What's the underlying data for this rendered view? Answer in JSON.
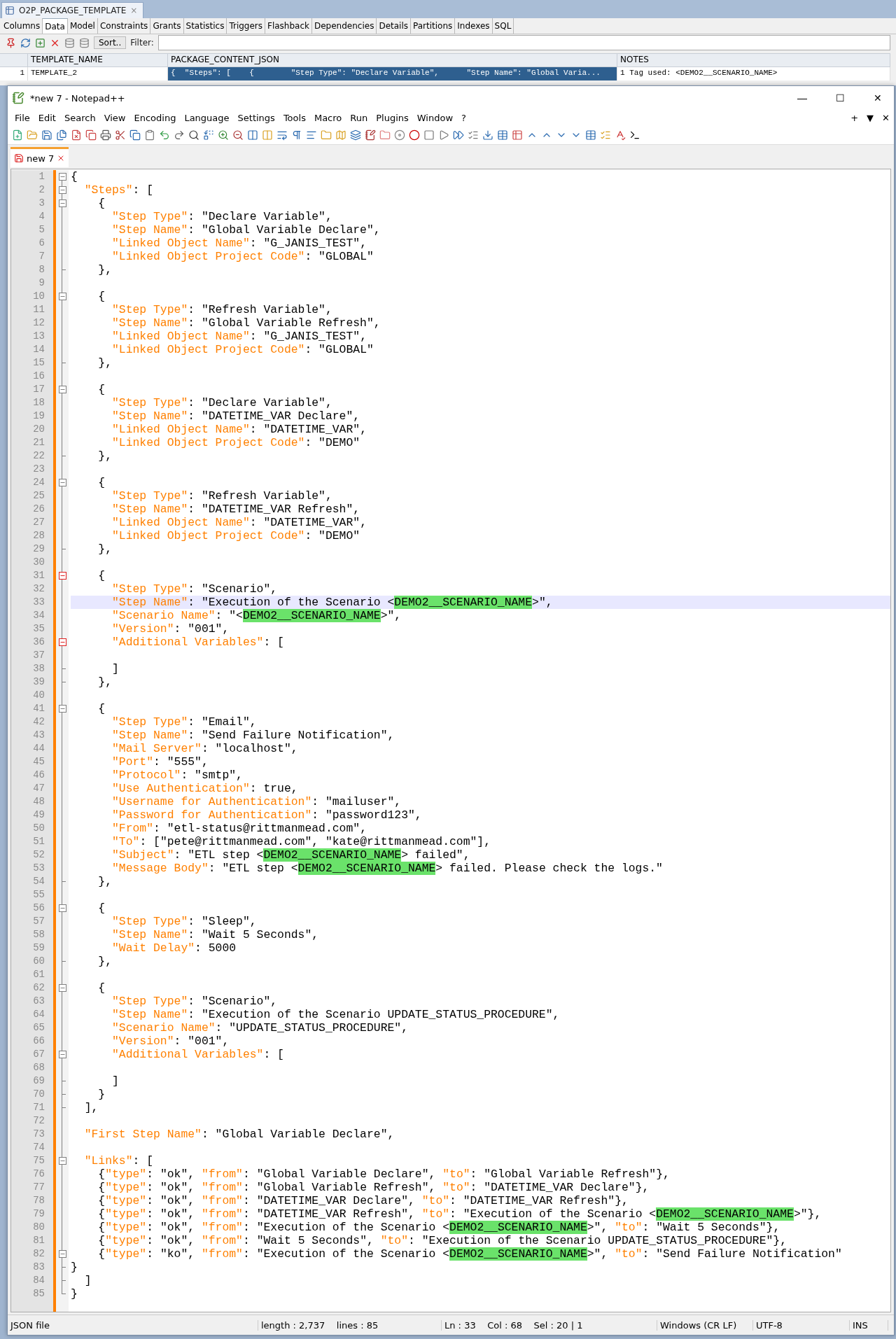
{
  "sql_developer": {
    "object_tab": {
      "title": "O2P_PACKAGE_TEMPLATE",
      "close": "×"
    },
    "tabs": [
      {
        "label": "Columns",
        "selected": false
      },
      {
        "label": "Data",
        "selected": true
      },
      {
        "label": "Model",
        "selected": false
      },
      {
        "label": "Constraints",
        "selected": false
      },
      {
        "label": "Grants",
        "selected": false
      },
      {
        "label": "Statistics",
        "selected": false
      },
      {
        "label": "Triggers",
        "selected": false
      },
      {
        "label": "Flashback",
        "selected": false
      },
      {
        "label": "Dependencies",
        "selected": false
      },
      {
        "label": "Details",
        "selected": false
      },
      {
        "label": "Partitions",
        "selected": false
      },
      {
        "label": "Indexes",
        "selected": false
      },
      {
        "label": "SQL",
        "selected": false
      }
    ],
    "sort_button": "Sort..",
    "filter_label": "Filter:",
    "grid": {
      "columns": [
        "TEMPLATE_NAME",
        "PACKAGE_CONTENT_JSON",
        "NOTES"
      ],
      "rows": [
        {
          "number": "1",
          "cells": [
            {
              "text": "TEMPLATE_2",
              "selected": false
            },
            {
              "text": "{  \"Steps\": [    {        \"Step Type\": \"Declare Variable\",      \"Step Name\": \"Global Varia...",
              "selected": true
            },
            {
              "text": "1 Tag used: <DEMO2__SCENARIO_NAME>",
              "selected": false
            }
          ]
        }
      ]
    }
  },
  "notepad": {
    "title": "*new 7 - Notepad++",
    "window_buttons": [
      "—",
      "☐",
      "✕"
    ],
    "menu": [
      "File",
      "Edit",
      "Search",
      "View",
      "Encoding",
      "Language",
      "Settings",
      "Tools",
      "Macro",
      "Run",
      "Plugins",
      "Window",
      "?"
    ],
    "menu_right": [
      "+",
      "▼",
      "✕"
    ],
    "tab": {
      "label": "new 7",
      "selected": true
    },
    "lines": [
      {
        "n": "1",
        "kind": "opener",
        "current": false,
        "segs": [
          {
            "kind": "text",
            "text": "{"
          }
        ]
      },
      {
        "n": "2",
        "kind": "opener",
        "current": false,
        "segs": [
          {
            "kind": "key",
            "text": "  \"Steps\""
          },
          {
            "kind": "text",
            "text": ": ["
          }
        ]
      },
      {
        "n": "3",
        "kind": "opener",
        "current": false,
        "segs": [
          {
            "kind": "text",
            "text": "    {"
          }
        ]
      },
      {
        "n": "4",
        "kind": "plain",
        "current": false,
        "segs": [
          {
            "kind": "key",
            "text": "      \"Step Type\""
          },
          {
            "kind": "text",
            "text": ": \"Declare Variable\","
          }
        ]
      },
      {
        "n": "5",
        "kind": "plain",
        "current": false,
        "segs": [
          {
            "kind": "key",
            "text": "      \"Step Name\""
          },
          {
            "kind": "text",
            "text": ": \"Global Variable Declare\","
          }
        ]
      },
      {
        "n": "6",
        "kind": "plain",
        "current": false,
        "segs": [
          {
            "kind": "key",
            "text": "      \"Linked Object Name\""
          },
          {
            "kind": "text",
            "text": ": \"G_JANIS_TEST\","
          }
        ]
      },
      {
        "n": "7",
        "kind": "plain",
        "current": false,
        "segs": [
          {
            "kind": "key",
            "text": "      \"Linked Object Project Code\""
          },
          {
            "kind": "text",
            "text": ": \"GLOBAL\""
          }
        ]
      },
      {
        "n": "8",
        "kind": "closer",
        "current": false,
        "segs": [
          {
            "kind": "text",
            "text": "    },"
          }
        ]
      },
      {
        "n": "9",
        "kind": "plain",
        "current": false
      },
      {
        "n": "10",
        "kind": "opener",
        "current": false,
        "segs": [
          {
            "kind": "text",
            "text": "    {"
          }
        ]
      },
      {
        "n": "11",
        "kind": "plain",
        "current": false,
        "segs": [
          {
            "kind": "key",
            "text": "      \"Step Type\""
          },
          {
            "kind": "text",
            "text": ": \"Refresh Variable\","
          }
        ]
      },
      {
        "n": "12",
        "kind": "plain",
        "current": false,
        "segs": [
          {
            "kind": "key",
            "text": "      \"Step Name\""
          },
          {
            "kind": "text",
            "text": ": \"Global Variable Refresh\","
          }
        ]
      },
      {
        "n": "13",
        "kind": "plain",
        "current": false,
        "segs": [
          {
            "kind": "key",
            "text": "      \"Linked Object Name\""
          },
          {
            "kind": "text",
            "text": ": \"G_JANIS_TEST\","
          }
        ]
      },
      {
        "n": "14",
        "kind": "plain",
        "current": false,
        "segs": [
          {
            "kind": "key",
            "text": "      \"Linked Object Project Code\""
          },
          {
            "kind": "text",
            "text": ": \"GLOBAL\""
          }
        ]
      },
      {
        "n": "15",
        "kind": "closer",
        "current": false,
        "segs": [
          {
            "kind": "text",
            "text": "    },"
          }
        ]
      },
      {
        "n": "16",
        "kind": "plain",
        "current": false
      },
      {
        "n": "17",
        "kind": "opener",
        "current": false,
        "segs": [
          {
            "kind": "text",
            "text": "    {"
          }
        ]
      },
      {
        "n": "18",
        "kind": "plain",
        "current": false,
        "segs": [
          {
            "kind": "key",
            "text": "      \"Step Type\""
          },
          {
            "kind": "text",
            "text": ": \"Declare Variable\","
          }
        ]
      },
      {
        "n": "19",
        "kind": "plain",
        "current": false,
        "segs": [
          {
            "kind": "key",
            "text": "      \"Step Name\""
          },
          {
            "kind": "text",
            "text": ": \"DATETIME_VAR Declare\","
          }
        ]
      },
      {
        "n": "20",
        "kind": "plain",
        "current": false,
        "segs": [
          {
            "kind": "key",
            "text": "      \"Linked Object Name\""
          },
          {
            "kind": "text",
            "text": ": \"DATETIME_VAR\","
          }
        ]
      },
      {
        "n": "21",
        "kind": "plain",
        "current": false,
        "segs": [
          {
            "kind": "key",
            "text": "      \"Linked Object Project Code\""
          },
          {
            "kind": "text",
            "text": ": \"DEMO\""
          }
        ]
      },
      {
        "n": "22",
        "kind": "closer",
        "current": false,
        "segs": [
          {
            "kind": "text",
            "text": "    },"
          }
        ]
      },
      {
        "n": "23",
        "kind": "plain",
        "current": false
      },
      {
        "n": "24",
        "kind": "opener",
        "current": false,
        "segs": [
          {
            "kind": "text",
            "text": "    {"
          }
        ]
      },
      {
        "n": "25",
        "kind": "plain",
        "current": false,
        "segs": [
          {
            "kind": "key",
            "text": "      \"Step Type\""
          },
          {
            "kind": "text",
            "text": ": \"Refresh Variable\","
          }
        ]
      },
      {
        "n": "26",
        "kind": "plain",
        "current": false,
        "segs": [
          {
            "kind": "key",
            "text": "      \"Step Name\""
          },
          {
            "kind": "text",
            "text": ": \"DATETIME_VAR Refresh\","
          }
        ]
      },
      {
        "n": "27",
        "kind": "plain",
        "current": false,
        "segs": [
          {
            "kind": "key",
            "text": "      \"Linked Object Name\""
          },
          {
            "kind": "text",
            "text": ": \"DATETIME_VAR\","
          }
        ]
      },
      {
        "n": "28",
        "kind": "plain",
        "current": false,
        "segs": [
          {
            "kind": "key",
            "text": "      \"Linked Object Project Code\""
          },
          {
            "kind": "text",
            "text": ": \"DEMO\""
          }
        ]
      },
      {
        "n": "29",
        "kind": "closer",
        "current": false,
        "segs": [
          {
            "kind": "text",
            "text": "    },"
          }
        ]
      },
      {
        "n": "30",
        "kind": "plain",
        "current": false
      },
      {
        "n": "31",
        "kind": "active",
        "current": false,
        "segs": [
          {
            "kind": "text",
            "text": "    {"
          }
        ]
      },
      {
        "n": "32",
        "kind": "plain",
        "current": false,
        "segs": [
          {
            "kind": "key",
            "text": "      \"Step Type\""
          },
          {
            "kind": "text",
            "text": ": \"Scenario\","
          }
        ]
      },
      {
        "n": "33",
        "kind": "plain",
        "current": true,
        "segs": [
          {
            "kind": "key",
            "text": "      \"Step Name\""
          },
          {
            "kind": "text",
            "text": ": \"Execution of the Scenario <"
          },
          {
            "kind": "match",
            "text": "DEMO2__SCENARIO_NAME"
          },
          {
            "kind": "text",
            "text": ">\","
          }
        ]
      },
      {
        "n": "34",
        "kind": "plain",
        "current": false,
        "segs": [
          {
            "kind": "key",
            "text": "      \"Scenario Name\""
          },
          {
            "kind": "text",
            "text": ": \"<"
          },
          {
            "kind": "match",
            "text": "DEMO2__SCENARIO_NAME"
          },
          {
            "kind": "text",
            "text": ">\","
          }
        ]
      },
      {
        "n": "35",
        "kind": "plain",
        "current": false,
        "segs": [
          {
            "kind": "key",
            "text": "      \"Version\""
          },
          {
            "kind": "text",
            "text": ": \"001\","
          }
        ]
      },
      {
        "n": "36",
        "kind": "active",
        "current": false,
        "segs": [
          {
            "kind": "key",
            "text": "      \"Additional Variables\""
          },
          {
            "kind": "text",
            "text": ": ["
          }
        ]
      },
      {
        "n": "37",
        "kind": "plain",
        "current": false
      },
      {
        "n": "38",
        "kind": "closer",
        "current": false,
        "segs": [
          {
            "kind": "text",
            "text": "      ]"
          }
        ]
      },
      {
        "n": "39",
        "kind": "closer",
        "current": false,
        "segs": [
          {
            "kind": "text",
            "text": "    },"
          }
        ]
      },
      {
        "n": "40",
        "kind": "plain",
        "current": false
      },
      {
        "n": "41",
        "kind": "opener",
        "current": false,
        "segs": [
          {
            "kind": "text",
            "text": "    {"
          }
        ]
      },
      {
        "n": "42",
        "kind": "plain",
        "current": false,
        "segs": [
          {
            "kind": "key",
            "text": "      \"Step Type\""
          },
          {
            "kind": "text",
            "text": ": \"Email\","
          }
        ]
      },
      {
        "n": "43",
        "kind": "plain",
        "current": false,
        "segs": [
          {
            "kind": "key",
            "text": "      \"Step Name\""
          },
          {
            "kind": "text",
            "text": ": \"Send Failure Notification\","
          }
        ]
      },
      {
        "n": "44",
        "kind": "plain",
        "current": false,
        "segs": [
          {
            "kind": "key",
            "text": "      \"Mail Server\""
          },
          {
            "kind": "text",
            "text": ": \"localhost\","
          }
        ]
      },
      {
        "n": "45",
        "kind": "plain",
        "current": false,
        "segs": [
          {
            "kind": "key",
            "text": "      \"Port\""
          },
          {
            "kind": "text",
            "text": ": \"555\","
          }
        ]
      },
      {
        "n": "46",
        "kind": "plain",
        "current": false,
        "segs": [
          {
            "kind": "key",
            "text": "      \"Protocol\""
          },
          {
            "kind": "text",
            "text": ": \"smtp\","
          }
        ]
      },
      {
        "n": "47",
        "kind": "plain",
        "current": false,
        "segs": [
          {
            "kind": "key",
            "text": "      \"Use Authentication\""
          },
          {
            "kind": "text",
            "text": ": true,"
          }
        ]
      },
      {
        "n": "48",
        "kind": "plain",
        "current": false,
        "segs": [
          {
            "kind": "key",
            "text": "      \"Username for Authentication\""
          },
          {
            "kind": "text",
            "text": ": \"mailuser\","
          }
        ]
      },
      {
        "n": "49",
        "kind": "plain",
        "current": false,
        "segs": [
          {
            "kind": "key",
            "text": "      \"Password for Authentication\""
          },
          {
            "kind": "text",
            "text": ": \"password123\","
          }
        ]
      },
      {
        "n": "50",
        "kind": "plain",
        "current": false,
        "segs": [
          {
            "kind": "key",
            "text": "      \"From\""
          },
          {
            "kind": "text",
            "text": ": \"etl-status@rittmanmead.com\","
          }
        ]
      },
      {
        "n": "51",
        "kind": "plain",
        "current": false,
        "segs": [
          {
            "kind": "key",
            "text": "      \"To\""
          },
          {
            "kind": "text",
            "text": ": [\"pete@rittmanmead.com\", \"kate@rittmanmead.com\"],"
          }
        ]
      },
      {
        "n": "52",
        "kind": "plain",
        "current": false,
        "segs": [
          {
            "kind": "key",
            "text": "      \"Subject\""
          },
          {
            "kind": "text",
            "text": ": \"ETL step <"
          },
          {
            "kind": "match",
            "text": "DEMO2__SCENARIO_NAME"
          },
          {
            "kind": "text",
            "text": "> failed\","
          }
        ]
      },
      {
        "n": "53",
        "kind": "plain",
        "current": false,
        "segs": [
          {
            "kind": "key",
            "text": "      \"Message Body\""
          },
          {
            "kind": "text",
            "text": ": \"ETL step <"
          },
          {
            "kind": "match",
            "text": "DEMO2__SCENARIO_NAME"
          },
          {
            "kind": "text",
            "text": "> failed. Please check the logs.\""
          }
        ]
      },
      {
        "n": "54",
        "kind": "closer",
        "current": false,
        "segs": [
          {
            "kind": "text",
            "text": "    },"
          }
        ]
      },
      {
        "n": "55",
        "kind": "plain",
        "current": false
      },
      {
        "n": "56",
        "kind": "opener",
        "current": false,
        "segs": [
          {
            "kind": "text",
            "text": "    {"
          }
        ]
      },
      {
        "n": "57",
        "kind": "plain",
        "current": false,
        "segs": [
          {
            "kind": "key",
            "text": "      \"Step Type\""
          },
          {
            "kind": "text",
            "text": ": \"Sleep\","
          }
        ]
      },
      {
        "n": "58",
        "kind": "plain",
        "current": false,
        "segs": [
          {
            "kind": "key",
            "text": "      \"Step Name\""
          },
          {
            "kind": "text",
            "text": ": \"Wait 5 Seconds\","
          }
        ]
      },
      {
        "n": "59",
        "kind": "plain",
        "current": false,
        "segs": [
          {
            "kind": "key",
            "text": "      \"Wait Delay\""
          },
          {
            "kind": "text",
            "text": ": 5000"
          }
        ]
      },
      {
        "n": "60",
        "kind": "closer",
        "current": false,
        "segs": [
          {
            "kind": "text",
            "text": "    },"
          }
        ]
      },
      {
        "n": "61",
        "kind": "plain",
        "current": false
      },
      {
        "n": "62",
        "kind": "opener",
        "current": false,
        "segs": [
          {
            "kind": "text",
            "text": "    {"
          }
        ]
      },
      {
        "n": "63",
        "kind": "plain",
        "current": false,
        "segs": [
          {
            "kind": "key",
            "text": "      \"Step Type\""
          },
          {
            "kind": "text",
            "text": ": \"Scenario\","
          }
        ]
      },
      {
        "n": "64",
        "kind": "plain",
        "current": false,
        "segs": [
          {
            "kind": "key",
            "text": "      \"Step Name\""
          },
          {
            "kind": "text",
            "text": ": \"Execution of the Scenario UPDATE_STATUS_PROCEDURE\","
          }
        ]
      },
      {
        "n": "65",
        "kind": "plain",
        "current": false,
        "segs": [
          {
            "kind": "key",
            "text": "      \"Scenario Name\""
          },
          {
            "kind": "text",
            "text": ": \"UPDATE_STATUS_PROCEDURE\","
          }
        ]
      },
      {
        "n": "66",
        "kind": "plain",
        "current": false,
        "segs": [
          {
            "kind": "key",
            "text": "      \"Version\""
          },
          {
            "kind": "text",
            "text": ": \"001\","
          }
        ]
      },
      {
        "n": "67",
        "kind": "opener",
        "current": false,
        "segs": [
          {
            "kind": "key",
            "text": "      \"Additional Variables\""
          },
          {
            "kind": "text",
            "text": ": ["
          }
        ]
      },
      {
        "n": "68",
        "kind": "plain",
        "current": false
      },
      {
        "n": "69",
        "kind": "closer",
        "current": false,
        "segs": [
          {
            "kind": "text",
            "text": "      ]"
          }
        ]
      },
      {
        "n": "70",
        "kind": "closer",
        "current": false,
        "segs": [
          {
            "kind": "text",
            "text": "    }"
          }
        ]
      },
      {
        "n": "71",
        "kind": "closer",
        "current": false,
        "segs": [
          {
            "kind": "text",
            "text": "  ],"
          }
        ]
      },
      {
        "n": "72",
        "kind": "plain",
        "current": false
      },
      {
        "n": "73",
        "kind": "plain",
        "current": false,
        "segs": [
          {
            "kind": "key",
            "text": "  \"First Step Name\""
          },
          {
            "kind": "text",
            "text": ": \"Global Variable Declare\","
          }
        ]
      },
      {
        "n": "74",
        "kind": "plain",
        "current": false
      },
      {
        "n": "75",
        "kind": "opener",
        "current": false,
        "segs": [
          {
            "kind": "key",
            "text": "  \"Links\""
          },
          {
            "kind": "text",
            "text": ": ["
          }
        ]
      },
      {
        "n": "76",
        "kind": "plain",
        "current": false,
        "segs": [
          {
            "kind": "text",
            "text": "    {"
          },
          {
            "kind": "key",
            "text": "\"type\""
          },
          {
            "kind": "text",
            "text": ": \"ok\", "
          },
          {
            "kind": "key",
            "text": "\"from\""
          },
          {
            "kind": "text",
            "text": ": \"Global Variable Declare\", "
          },
          {
            "kind": "key",
            "text": "\"to\""
          },
          {
            "kind": "text",
            "text": ": \"Global Variable Refresh\"},"
          }
        ]
      },
      {
        "n": "77",
        "kind": "plain",
        "current": false,
        "segs": [
          {
            "kind": "text",
            "text": "    {"
          },
          {
            "kind": "key",
            "text": "\"type\""
          },
          {
            "kind": "text",
            "text": ": \"ok\", "
          },
          {
            "kind": "key",
            "text": "\"from\""
          },
          {
            "kind": "text",
            "text": ": \"Global Variable Refresh\", "
          },
          {
            "kind": "key",
            "text": "\"to\""
          },
          {
            "kind": "text",
            "text": ": \"DATETIME_VAR Declare\"},"
          }
        ]
      },
      {
        "n": "78",
        "kind": "plain",
        "current": false,
        "segs": [
          {
            "kind": "text",
            "text": "    {"
          },
          {
            "kind": "key",
            "text": "\"type\""
          },
          {
            "kind": "text",
            "text": ": \"ok\", "
          },
          {
            "kind": "key",
            "text": "\"from\""
          },
          {
            "kind": "text",
            "text": ": \"DATETIME_VAR Declare\", "
          },
          {
            "kind": "key",
            "text": "\"to\""
          },
          {
            "kind": "text",
            "text": ": \"DATETIME_VAR Refresh\"},"
          }
        ]
      },
      {
        "n": "79",
        "kind": "plain",
        "current": false,
        "segs": [
          {
            "kind": "text",
            "text": "    {"
          },
          {
            "kind": "key",
            "text": "\"type\""
          },
          {
            "kind": "text",
            "text": ": \"ok\", "
          },
          {
            "kind": "key",
            "text": "\"from\""
          },
          {
            "kind": "text",
            "text": ": \"DATETIME_VAR Refresh\", "
          },
          {
            "kind": "key",
            "text": "\"to\""
          },
          {
            "kind": "text",
            "text": ": \"Execution of the Scenario <"
          },
          {
            "kind": "match",
            "text": "DEMO2__SCENARIO_NAME"
          },
          {
            "kind": "text",
            "text": ">\"},"
          }
        ]
      },
      {
        "n": "80",
        "kind": "plain",
        "current": false,
        "segs": [
          {
            "kind": "text",
            "text": "    {"
          },
          {
            "kind": "key",
            "text": "\"type\""
          },
          {
            "kind": "text",
            "text": ": \"ok\", "
          },
          {
            "kind": "key",
            "text": "\"from\""
          },
          {
            "kind": "text",
            "text": ": \"Execution of the Scenario <"
          },
          {
            "kind": "match",
            "text": "DEMO2__SCENARIO_NAME"
          },
          {
            "kind": "text",
            "text": ">\", "
          },
          {
            "kind": "key",
            "text": "\"to\""
          },
          {
            "kind": "text",
            "text": ": \"Wait 5 Seconds\"},"
          }
        ]
      },
      {
        "n": "81",
        "kind": "plain",
        "current": false,
        "segs": [
          {
            "kind": "text",
            "text": "    {"
          },
          {
            "kind": "key",
            "text": "\"type\""
          },
          {
            "kind": "text",
            "text": ": \"ok\", "
          },
          {
            "kind": "key",
            "text": "\"from\""
          },
          {
            "kind": "text",
            "text": ": \"Wait 5 Seconds\", "
          },
          {
            "kind": "key",
            "text": "\"to\""
          },
          {
            "kind": "text",
            "text": ": \"Execution of the Scenario UPDATE_STATUS_PROCEDURE\"},"
          }
        ]
      },
      {
        "n": "82",
        "kind": "opener",
        "current": false,
        "segs": [
          {
            "kind": "text",
            "text": "    {"
          },
          {
            "kind": "key",
            "text": "\"type\""
          },
          {
            "kind": "text",
            "text": ": \"ko\", "
          },
          {
            "kind": "key",
            "text": "\"from\""
          },
          {
            "kind": "text",
            "text": ": \"Execution of the Scenario <"
          },
          {
            "kind": "match",
            "text": "DEMO2__SCENARIO_NAME"
          },
          {
            "kind": "text",
            "text": ">\", "
          },
          {
            "kind": "key",
            "text": "\"to\""
          },
          {
            "kind": "text",
            "text": ": \"Send Failure Notification\""
          }
        ]
      },
      {
        "n": "83",
        "kind": "closer",
        "current": false,
        "segs": [
          {
            "kind": "text",
            "text": "}"
          }
        ]
      },
      {
        "n": "84",
        "kind": "closer",
        "current": false,
        "segs": [
          {
            "kind": "text",
            "text": "  ]"
          }
        ]
      },
      {
        "n": "85",
        "kind": "closer",
        "current": false,
        "segs": [
          {
            "kind": "text",
            "text": "}"
          }
        ]
      }
    ],
    "status_bar": [
      "JSON file",
      "length : 2,737    lines : 85",
      "Ln : 33    Col : 68    Sel : 20 | 1",
      "Windows (CR LF)",
      "UTF-8",
      "INS"
    ]
  }
}
